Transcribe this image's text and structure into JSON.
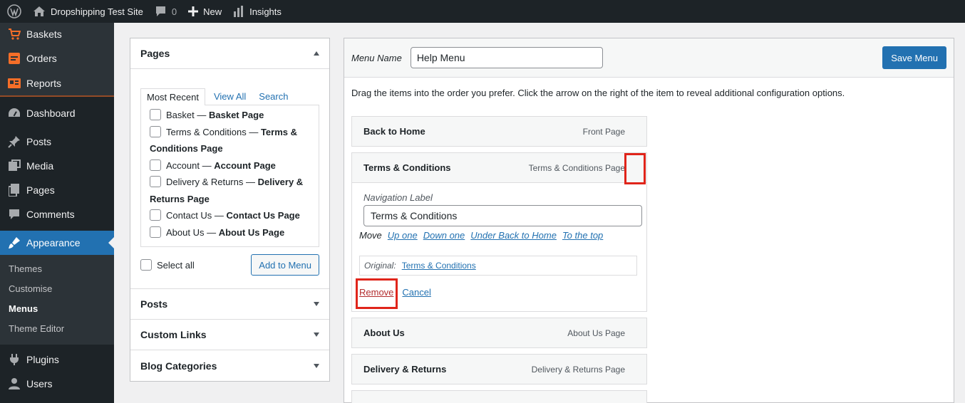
{
  "adminbar": {
    "site_name": "Dropshipping Test Site",
    "comments_count": "0",
    "new_label": "New",
    "insights_label": "Insights"
  },
  "sidebar": {
    "woo_items": [
      {
        "label": "Baskets",
        "icon": "cart-icon"
      },
      {
        "label": "Orders",
        "icon": "orders-icon"
      },
      {
        "label": "Reports",
        "icon": "reports-icon"
      }
    ],
    "items": [
      {
        "label": "Dashboard",
        "icon": "dashboard-icon"
      },
      {
        "label": "Posts",
        "icon": "pin-icon"
      },
      {
        "label": "Media",
        "icon": "media-icon"
      },
      {
        "label": "Pages",
        "icon": "pages-icon"
      },
      {
        "label": "Comments",
        "icon": "comment-icon"
      },
      {
        "label": "Appearance",
        "icon": "brush-icon"
      }
    ],
    "appearance_sub": [
      "Themes",
      "Customise",
      "Menus",
      "Theme Editor"
    ],
    "bottom_items": [
      {
        "label": "Plugins",
        "icon": "plugin-icon"
      },
      {
        "label": "Users",
        "icon": "users-icon"
      }
    ]
  },
  "left_panel": {
    "pages_title": "Pages",
    "tabs": [
      "Most Recent",
      "View All",
      "Search"
    ],
    "page_items": [
      {
        "title": "Basket",
        "sep": " — ",
        "type": "Basket Page"
      },
      {
        "title": "Terms & Conditions",
        "sep": " — ",
        "type": "Terms & Conditions Page"
      },
      {
        "title": "Account",
        "sep": " — ",
        "type": "Account Page"
      },
      {
        "title": "Delivery & Returns",
        "sep": " — ",
        "type": "Delivery & Returns Page"
      },
      {
        "title": "Contact Us",
        "sep": " — ",
        "type": "Contact Us Page"
      },
      {
        "title": "About Us",
        "sep": " — ",
        "type": "About Us Page"
      }
    ],
    "select_all": "Select all",
    "add_to_menu": "Add to Menu",
    "sections": [
      "Posts",
      "Custom Links",
      "Blog Categories"
    ]
  },
  "right_panel": {
    "menu_name_label": "Menu Name",
    "menu_name_value": "Help Menu",
    "save_button": "Save Menu",
    "instructions": "Drag the items into the order you prefer. Click the arrow on the right of the item to reveal additional configuration options.",
    "menu_items": [
      {
        "title": "Back to Home",
        "type": "Front Page"
      },
      {
        "title": "Terms & Conditions",
        "type": "Terms & Conditions Page"
      },
      {
        "title": "About Us",
        "type": "About Us Page"
      },
      {
        "title": "Delivery & Returns",
        "type": "Delivery & Returns Page"
      }
    ],
    "settings": {
      "nav_label": "Navigation Label",
      "nav_value": "Terms & Conditions",
      "move_label": "Move",
      "move_links": [
        "Up one",
        "Down one",
        "Under Back to Home",
        "To the top"
      ],
      "original_label": "Original:",
      "original_link": "Terms & Conditions",
      "remove": "Remove",
      "cancel": "Cancel"
    }
  },
  "colors": {
    "accent": "#2271b1",
    "admin_dark": "#1d2327",
    "woo_orange": "#f56e28",
    "highlight": "#e0251b"
  }
}
